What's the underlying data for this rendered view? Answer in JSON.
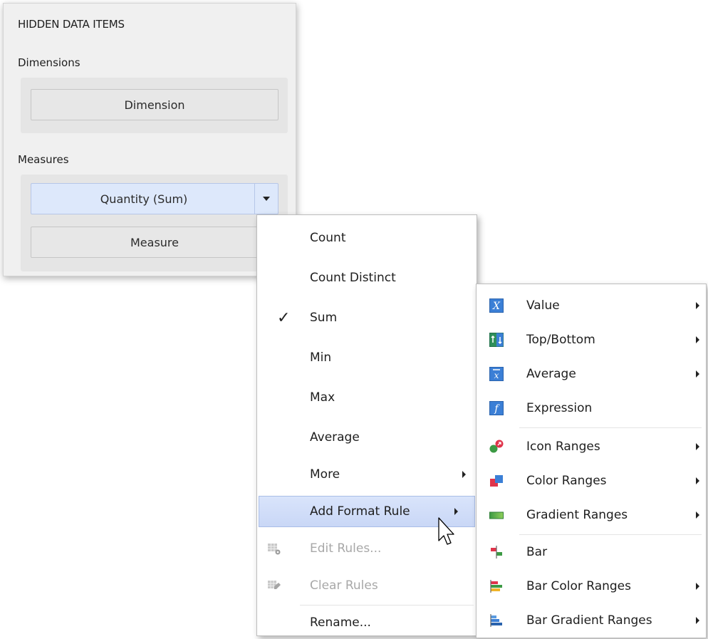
{
  "panel": {
    "title": "HIDDEN DATA ITEMS",
    "dimensions_label": "Dimensions",
    "dimension_button": "Dimension",
    "measures_label": "Measures",
    "quantity_button": "Quantity (Sum)",
    "measure_button": "Measure"
  },
  "menu": {
    "items": [
      {
        "label": "Count"
      },
      {
        "label": "Count Distinct"
      },
      {
        "label": "Sum",
        "checked": true
      },
      {
        "label": "Min"
      },
      {
        "label": "Max"
      },
      {
        "label": "Average"
      },
      {
        "label": "More",
        "submenu": true
      },
      {
        "label": "Add Format Rule",
        "submenu": true,
        "highlighted": true
      },
      {
        "label": "Edit Rules...",
        "disabled": true,
        "icon": "edit-rules-icon"
      },
      {
        "label": "Clear Rules",
        "disabled": true,
        "icon": "clear-rules-icon"
      },
      {
        "label": "Rename..."
      }
    ]
  },
  "submenu": {
    "items": [
      {
        "label": "Value",
        "icon": "value-icon",
        "submenu": true
      },
      {
        "label": "Top/Bottom",
        "icon": "top-bottom-icon",
        "submenu": true
      },
      {
        "label": "Average",
        "icon": "average-icon",
        "submenu": true
      },
      {
        "label": "Expression",
        "icon": "expression-icon"
      },
      {
        "label": "Icon Ranges",
        "icon": "icon-ranges-icon",
        "submenu": true
      },
      {
        "label": "Color Ranges",
        "icon": "color-ranges-icon",
        "submenu": true
      },
      {
        "label": "Gradient Ranges",
        "icon": "gradient-ranges-icon",
        "submenu": true
      },
      {
        "label": "Bar",
        "icon": "bar-icon"
      },
      {
        "label": "Bar Color Ranges",
        "icon": "bar-color-ranges-icon",
        "submenu": true
      },
      {
        "label": "Bar Gradient Ranges",
        "icon": "bar-gradient-ranges-icon",
        "submenu": true
      }
    ]
  },
  "colors": {
    "highlight": "#c9d7f6",
    "selected_field": "#dde8fb",
    "disabled_text": "#a8a8a8"
  }
}
